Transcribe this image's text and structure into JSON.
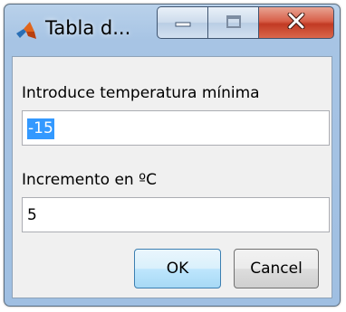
{
  "window": {
    "title": "Tabla d...",
    "close_glyph": "x",
    "icon_name": "matlab-icon"
  },
  "dialog": {
    "field1": {
      "label": "Introduce temperatura mínima",
      "value": "-15",
      "selected": true
    },
    "field2": {
      "label": "Incremento en ºC",
      "value": "5"
    },
    "ok_label": "OK",
    "cancel_label": "Cancel"
  },
  "colors": {
    "selection": "#3399ff",
    "close_button": "#c23a23",
    "frame": "#a7c4e4"
  }
}
